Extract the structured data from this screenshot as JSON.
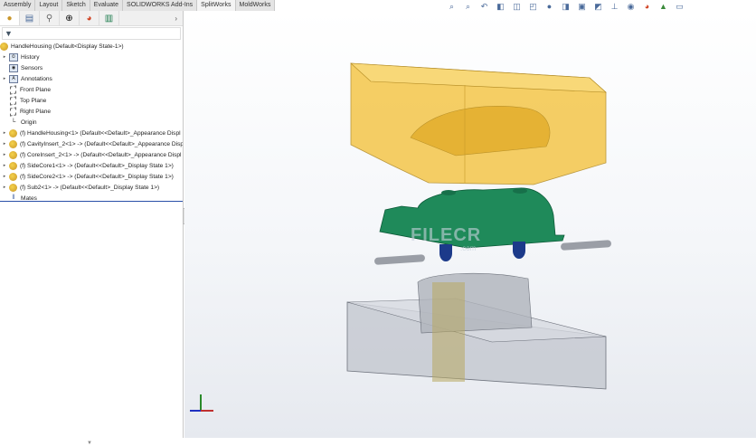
{
  "tabs": [
    "Assembly",
    "Layout",
    "Sketch",
    "Evaluate",
    "SOLIDWORKS Add-Ins",
    "SplitWorks",
    "MoldWorks"
  ],
  "active_tab": "SplitWorks",
  "panel_icons": [
    "feature-manager-icon",
    "property-manager-icon",
    "configuration-manager-icon",
    "dimxpert-icon",
    "display-manager-icon",
    "cam-icon"
  ],
  "filter_symbol": "▼",
  "tree": {
    "root": "HandleHousing  (Default<Display State-1>)",
    "items": [
      {
        "label": "History",
        "icon": "history-icon",
        "expandable": true
      },
      {
        "label": "Sensors",
        "icon": "sensors-icon",
        "expandable": false
      },
      {
        "label": "Annotations",
        "icon": "annotations-icon",
        "expandable": true
      },
      {
        "label": "Front Plane",
        "icon": "plane-icon",
        "expandable": false
      },
      {
        "label": "Top Plane",
        "icon": "plane-icon",
        "expandable": false
      },
      {
        "label": "Right Plane",
        "icon": "plane-icon",
        "expandable": false
      },
      {
        "label": "Origin",
        "icon": "origin-icon",
        "expandable": false
      },
      {
        "label": "(f) HandleHousing<1> (Default<<Default>_Appearance Displ",
        "icon": "part-icon",
        "expandable": true
      },
      {
        "label": "(f) CavityInsert_2<1> -> (Default<<Default>_Appearance Disp",
        "icon": "part-icon",
        "expandable": true
      },
      {
        "label": "(f) CoreInsert_2<1> -> (Default<<Default>_Appearance Displ",
        "icon": "part-icon",
        "expandable": true
      },
      {
        "label": "(f) SideCore1<1> -> (Default<<Default>_Display State 1>)",
        "icon": "part-icon",
        "expandable": true
      },
      {
        "label": "(f) SideCore2<1> -> (Default<<Default>_Display State 1>)",
        "icon": "part-icon",
        "expandable": true
      },
      {
        "label": "(f) Sub2<1> -> (Default<<Default>_Display State 1>)",
        "icon": "part-icon",
        "expandable": true
      },
      {
        "label": "Mates",
        "icon": "mates-icon",
        "expandable": false
      }
    ]
  },
  "watermark": {
    "main": "FILECR",
    ".com": ".com"
  },
  "colors": {
    "cavity": "#f2c030",
    "core": "#1f8a5a",
    "base": "#b8bcc4",
    "accent": "#2a4fa8"
  }
}
